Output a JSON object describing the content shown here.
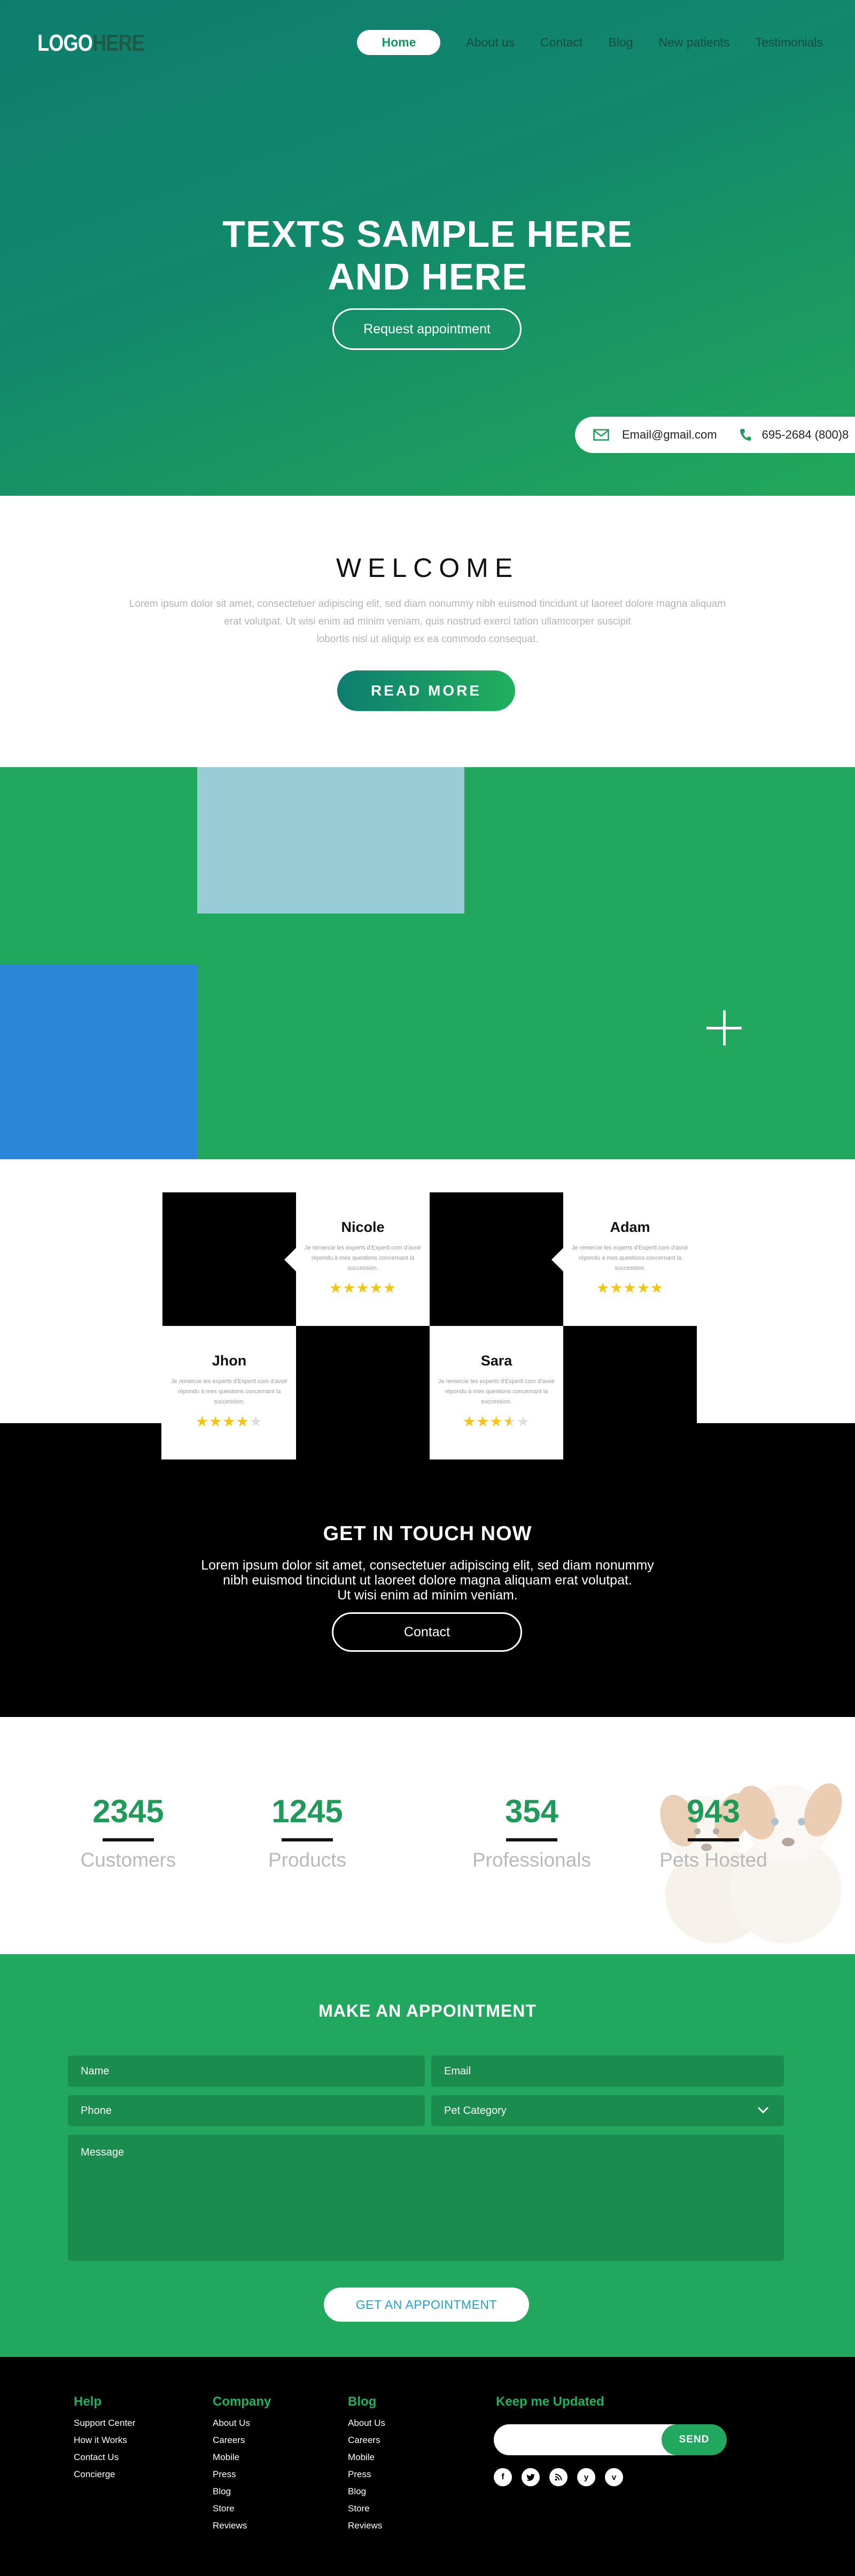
{
  "header": {
    "logo_part1": "LOGO",
    "logo_part2": "HERE",
    "nav": [
      "Home",
      "About us",
      "Contact",
      "Blog",
      "New patients",
      "Testimonials"
    ]
  },
  "hero": {
    "title_line1": "TEXTS SAMPLE HERE",
    "title_line2": "AND HERE",
    "button": "Request appointment",
    "email": "Email@gmail.com",
    "phone": "695-2684 (800)8"
  },
  "welcome": {
    "title": "WELCOME",
    "text_line1": "Lorem ipsum dolor sit amet, consectetuer adipiscing elit, sed diam nonummy nibh euismod tincidunt ut laoreet dolore magna aliquam",
    "text_line2": "erat volutpat. Ut wisi enim ad minim veniam, quis nostrud exerci tation ullamcorper suscipit",
    "text_line3": "lobortis nisl ut aliquip ex ea commodo consequat.",
    "button": "READ MORE"
  },
  "team": [
    {
      "name": "Nicole",
      "text": "Je remercie les experts d'Expertl.com d'avoir répondu à mes questions concernant la succession.",
      "rating": 5
    },
    {
      "name": "Adam",
      "text": "Je remercie les experts d'Expertl.com d'avoir répondu à mes questions concernant la succession.",
      "rating": 5
    },
    {
      "name": "Jhon",
      "text": "Je remercie les experts d'Expertl.com d'avoir répondu à mes questions concernant la succession.",
      "rating": 4
    },
    {
      "name": "Sara",
      "text": "Je remercie les experts d'Expertl.com d'avoir répondu à mes questions concernant la succession.",
      "rating": 3.5
    }
  ],
  "cta": {
    "title": "GET IN TOUCH NOW",
    "line1": "Lorem ipsum dolor sit amet, consectetuer adipiscing elit, sed diam nonummy",
    "line2": "nibh euismod tincidunt ut laoreet dolore magna aliquam erat volutpat.",
    "line3": "Ut wisi enim ad minim veniam.",
    "button": "Contact"
  },
  "stats": [
    {
      "value": "2345",
      "label": "Customers"
    },
    {
      "value": "1245",
      "label": "Products"
    },
    {
      "value": "354",
      "label": "Professionals"
    },
    {
      "value": "943",
      "label": "Pets Hosted"
    }
  ],
  "appointment": {
    "title": "MAKE AN APPOINTMENT",
    "name_placeholder": "Name",
    "email_placeholder": "Email",
    "phone_placeholder": "Phone",
    "category": "Pet Category",
    "message_placeholder": "Message",
    "button": "GET AN APPOINTMENT"
  },
  "footer": {
    "help_title": "Help",
    "help_links": [
      "Support Center",
      "How it Works",
      "Contact Us",
      "Concierge"
    ],
    "company_title": "Company",
    "company_links": [
      "About Us",
      "Careers",
      "Mobile",
      "Press",
      "Blog",
      "Store",
      "Reviews"
    ],
    "blog_title": "Blog",
    "blog_links": [
      "About Us",
      "Careers",
      "Mobile",
      "Press",
      "Blog",
      "Store",
      "Reviews"
    ],
    "newsletter_title": "Keep me Updated",
    "send_button": "SEND",
    "socials": [
      "f",
      "t",
      "rss",
      "y",
      "v"
    ]
  },
  "colors": {
    "green": "#22a85e",
    "teal": "#0e7d6f",
    "light_blue_block": "#98ccd6",
    "blue_block": "#2a86d8",
    "star": "#f2c414"
  }
}
